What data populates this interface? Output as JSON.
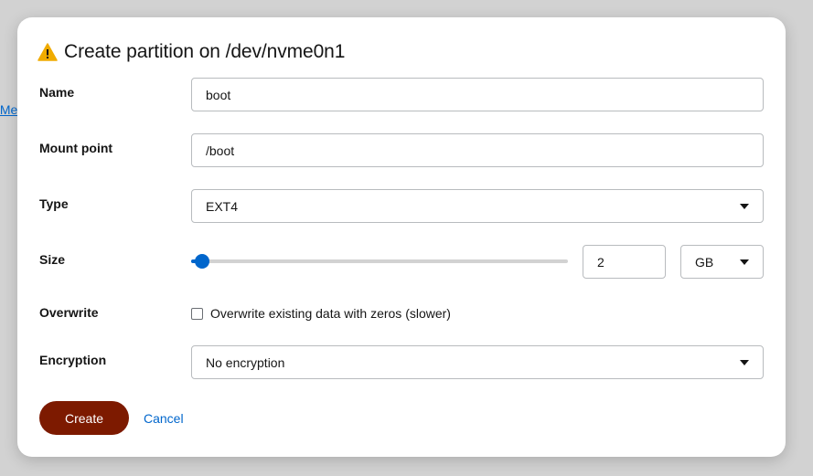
{
  "background": {
    "link_fragment": "/Me"
  },
  "dialog": {
    "title": "Create partition on /dev/nvme0n1",
    "warning_icon": "warning-triangle-icon",
    "warning_color": "#f0ab00"
  },
  "form": {
    "name": {
      "label": "Name",
      "value": "boot"
    },
    "mount_point": {
      "label": "Mount point",
      "value": "/boot"
    },
    "type": {
      "label": "Type",
      "value": "EXT4"
    },
    "size": {
      "label": "Size",
      "slider_fraction": 0.03,
      "value": "2",
      "unit": "GB"
    },
    "overwrite": {
      "label": "Overwrite",
      "checkbox_label": "Overwrite existing data with zeros (slower)",
      "checked": false
    },
    "encryption": {
      "label": "Encryption",
      "value": "No encryption"
    }
  },
  "actions": {
    "create_label": "Create",
    "cancel_label": "Cancel"
  },
  "colors": {
    "primary_button": "#7d1a00",
    "link": "#0066cc",
    "slider": "#0066cc"
  }
}
